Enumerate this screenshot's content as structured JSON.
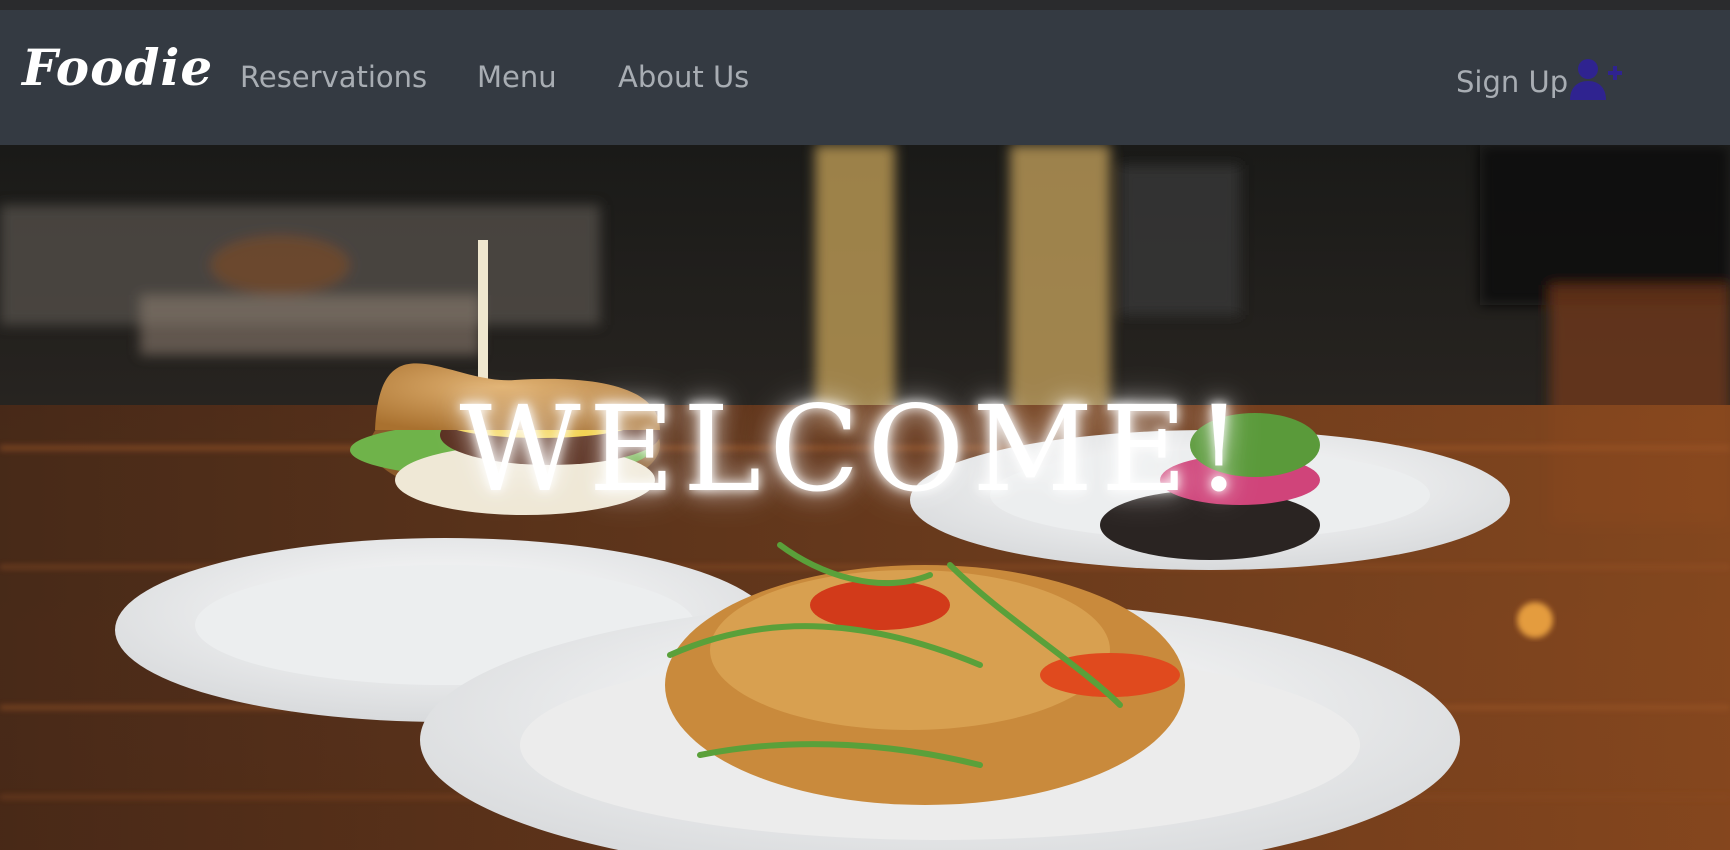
{
  "navbar": {
    "brand": "Foodie",
    "links": [
      {
        "label": "Reservations"
      },
      {
        "label": "Menu"
      },
      {
        "label": "About Us"
      }
    ],
    "signup_label": "Sign Up",
    "signup_icon": "user-plus-icon",
    "signup_icon_color": "#2f2390"
  },
  "hero": {
    "heading": "WELCOME!",
    "image": "food-plates-photo"
  },
  "colors": {
    "navbar_bg": "#343a42",
    "nav_text": "#a8adb3",
    "heading_text": "#ffffff"
  }
}
